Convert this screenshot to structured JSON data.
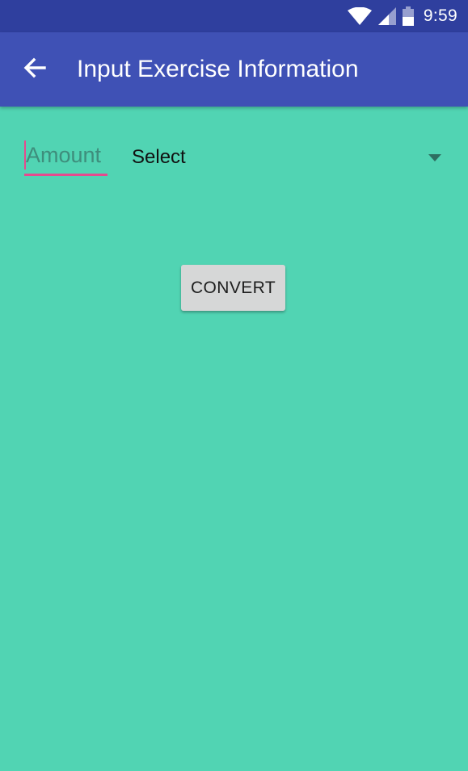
{
  "status_bar": {
    "time": "9:59",
    "icons": [
      "wifi-icon",
      "cell-signal-icon",
      "battery-icon"
    ]
  },
  "app_bar": {
    "title": "Input Exercise Information",
    "back_icon": "arrow-left-icon"
  },
  "form": {
    "amount_placeholder": "Amount",
    "amount_value": "",
    "select_label": "Select",
    "select_icon": "dropdown-triangle-icon",
    "convert_label": "CONVERT"
  },
  "colors": {
    "status_bar": "#2F3F9E",
    "app_bar": "#3F51B5",
    "background": "#51D4B3",
    "accent": "#E64A8E",
    "button": "#D6D7D7"
  }
}
